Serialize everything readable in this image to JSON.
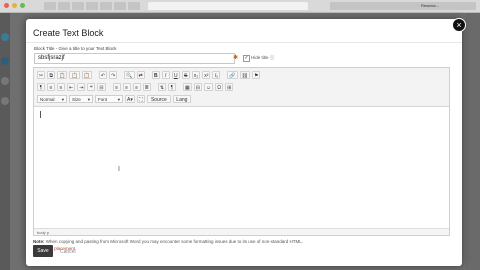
{
  "browser": {
    "tab_labels": [
      "Researc..."
    ]
  },
  "modal": {
    "title": "Create Text Block",
    "close_glyph": "×",
    "block_title_label": "Block Title - Give a title to your Text Block",
    "block_title_value": "sbsfjsrazjf",
    "required_mark": "✱",
    "hide_title_label": "Hide title ⓘ",
    "hide_title_checked": "✓"
  },
  "editor": {
    "toolbar_row1": [
      "✂",
      "⧉",
      "📋",
      "📋",
      "📋",
      "↶",
      "↷",
      "🔍",
      "⇄",
      "B",
      "I",
      "U",
      "S",
      "x₂",
      "x²",
      "𝐼ₓ",
      "🔗",
      "⛓",
      "⚑"
    ],
    "toolbar_row2": [
      "¶",
      "≡",
      "≡",
      "⇤",
      "⇥",
      "❝",
      "⊟",
      "≡",
      "≡",
      "≡",
      "≣",
      "⇅",
      "¶",
      "▦",
      "⊟",
      "☺",
      "Ω",
      "⊞"
    ],
    "format_select": "Normal",
    "style_select": "Size",
    "font_select": "Font",
    "source_label": "Source",
    "lang_label": "Lang",
    "status_path": "body p"
  },
  "footer": {
    "note_label": "Note:",
    "note_text": "When copying and pasting from Microsoft Word you may encounter some formatting issues due to its use of non-standard HTML.",
    "block_placement": "+ Block placement",
    "save_label": "Save",
    "cancel_label": "Cancel"
  },
  "colors": {
    "required": "#e05a00",
    "link": "#c0392b",
    "primary_button": "#3a3a3a"
  }
}
